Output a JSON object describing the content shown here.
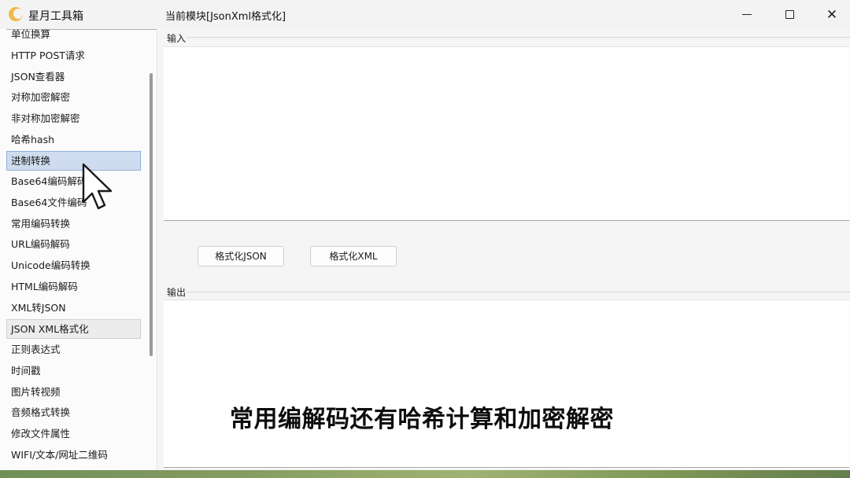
{
  "titlebar": {
    "app_title": "星月工具箱",
    "module_title": "当前模块[JsonXml格式化]",
    "app_icon": "crescent-moon-icon",
    "min_icon": "minimize-icon",
    "max_icon": "maximize-icon",
    "close_icon": "close-icon",
    "close_glyph": "✕"
  },
  "sidebar": {
    "items": [
      {
        "label": "单位换算"
      },
      {
        "label": "HTTP POST请求"
      },
      {
        "label": "JSON查看器"
      },
      {
        "label": "对称加密解密"
      },
      {
        "label": "非对称加密解密"
      },
      {
        "label": "哈希hash"
      },
      {
        "label": "进制转换",
        "state": "selected"
      },
      {
        "label": "Base64编码解码"
      },
      {
        "label": "Base64文件编码"
      },
      {
        "label": "常用编码转换"
      },
      {
        "label": "URL编码解码"
      },
      {
        "label": "Unicode编码转换"
      },
      {
        "label": "HTML编码解码"
      },
      {
        "label": "XML转JSON"
      },
      {
        "label": "JSON XML格式化",
        "state": "hover"
      },
      {
        "label": "正则表达式"
      },
      {
        "label": "时间戳"
      },
      {
        "label": "图片转视频"
      },
      {
        "label": "音频格式转换"
      },
      {
        "label": "修改文件属性"
      },
      {
        "label": "WIFI/文本/网址二维码"
      }
    ]
  },
  "main": {
    "input_label": "输入",
    "input_value": "",
    "output_label": "输出",
    "output_value": "",
    "format_json_label": "格式化JSON",
    "format_xml_label": "格式化XML"
  },
  "overlay": {
    "caption": "常用编解码还有哈希计算和加密解密",
    "cursor_icon": "mouse-pointer-icon"
  },
  "colors": {
    "selected_bg": "#cfdcef",
    "selected_border": "#8fb0dc",
    "app_icon": "#f0b84a"
  }
}
